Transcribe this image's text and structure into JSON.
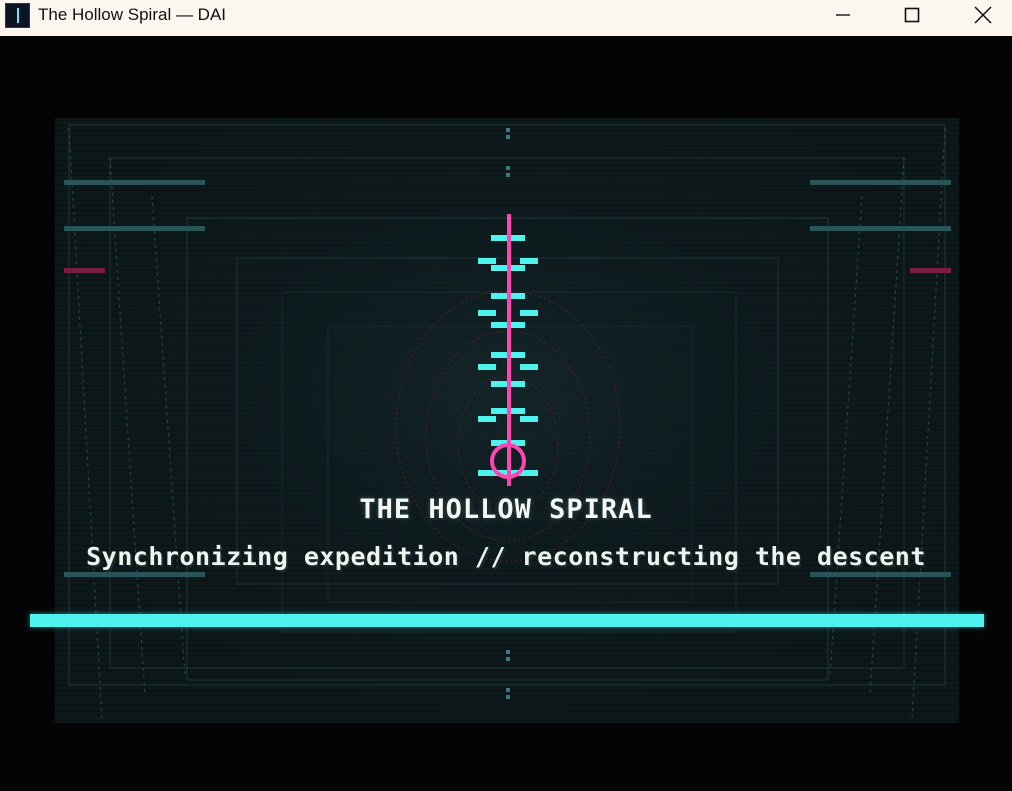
{
  "window": {
    "title": "The Hollow Spiral — DAI",
    "controls": {
      "minimize_icon": "minimize-icon",
      "maximize_icon": "maximize-icon",
      "close_icon": "close-icon"
    }
  },
  "game": {
    "title": "THE HOLLOW SPIRAL",
    "status": "Synchronizing expedition // reconstructing the descent",
    "progress": 1.0,
    "colors": {
      "background": "#040404",
      "accent_cyan": "#4ff3ee",
      "accent_magenta": "#ff45b0",
      "frame_teal": "#2a5558",
      "marker_red": "#7a1c3e"
    }
  }
}
